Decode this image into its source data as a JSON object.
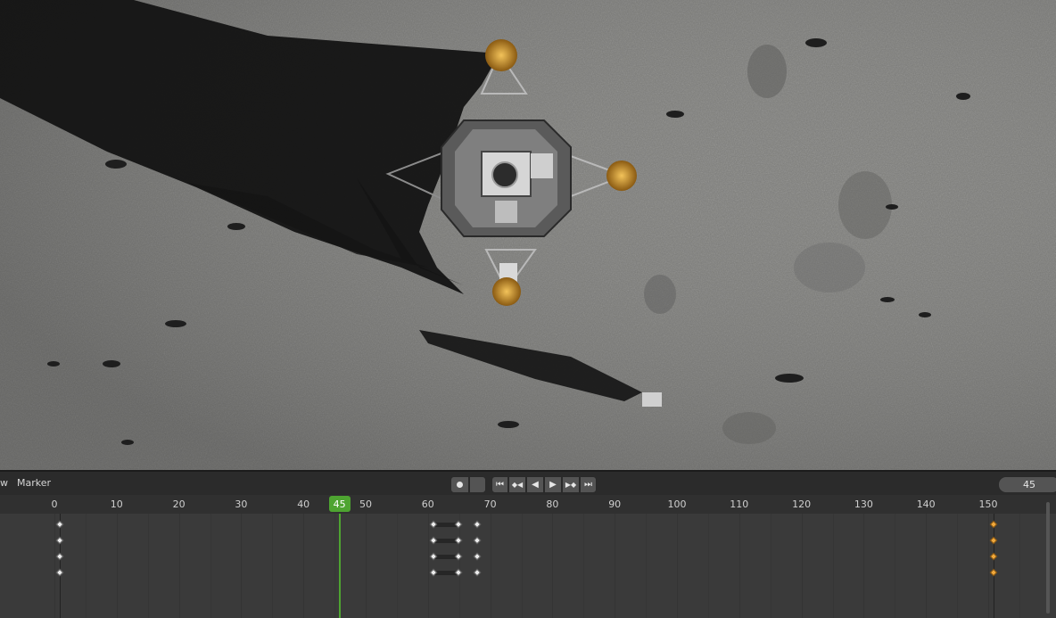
{
  "viewport": {
    "scene": "lunar-module-top-view-render"
  },
  "timeline": {
    "menus": [
      {
        "id": "view",
        "label": "w"
      },
      {
        "id": "marker",
        "label": "Marker"
      }
    ],
    "transport": {
      "record_icon": "record-icon",
      "buttons": [
        {
          "id": "jump-start",
          "icon": "jump-to-start-icon",
          "glyph": "⏮"
        },
        {
          "id": "prev-key",
          "icon": "previous-keyframe-icon",
          "glyph": "◆◀"
        },
        {
          "id": "play-reverse",
          "icon": "play-reverse-icon",
          "glyph": "◀"
        },
        {
          "id": "play",
          "icon": "play-icon",
          "glyph": "▶"
        },
        {
          "id": "next-key",
          "icon": "next-keyframe-icon",
          "glyph": "▶◆"
        },
        {
          "id": "jump-end",
          "icon": "jump-to-end-icon",
          "glyph": "⏭"
        }
      ]
    },
    "current_frame": "45",
    "current_frame_value": 45,
    "ruler": {
      "labels": [
        "0",
        "10",
        "20",
        "30",
        "40",
        "50",
        "60",
        "70",
        "80",
        "90",
        "100",
        "110",
        "120",
        "130",
        "140",
        "150"
      ],
      "values": [
        0,
        10,
        20,
        30,
        40,
        50,
        60,
        70,
        80,
        90,
        100,
        110,
        120,
        130,
        140,
        150
      ]
    },
    "keyframes": [
      {
        "frame": 0,
        "rows": 4,
        "selected": false
      },
      {
        "frame": 60,
        "rows": 4,
        "selected": false
      },
      {
        "frame": 64,
        "rows": 4,
        "selected": false
      },
      {
        "frame": 67,
        "rows": 4,
        "selected": false
      },
      {
        "frame": 150,
        "rows": 4,
        "selected": true
      }
    ],
    "holds": [
      {
        "from": 60,
        "to": 64
      }
    ],
    "colors": {
      "playhead": "#4ea431",
      "selected_key": "#f0a83b",
      "key": "#ececec"
    }
  }
}
